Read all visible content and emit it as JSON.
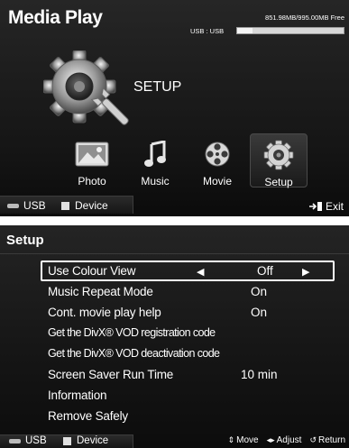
{
  "media_play": {
    "title": "Media Play",
    "usb_capacity": "851.98MB/995.00MB Free",
    "usb_label": "USB : USB",
    "usb_usage_fraction": 0.144,
    "hero_label": "SETUP",
    "items": [
      {
        "label": "Photo",
        "icon": "photo-icon"
      },
      {
        "label": "Music",
        "icon": "music-icon"
      },
      {
        "label": "Movie",
        "icon": "movie-icon"
      },
      {
        "label": "Setup",
        "icon": "gear-icon",
        "selected": true
      }
    ],
    "footer": {
      "usb_label": "USB",
      "device_label": "Device",
      "exit_label": "Exit"
    }
  },
  "setup": {
    "title": "Setup",
    "rows": [
      {
        "label": "Use Colour View",
        "value": "Off",
        "selected": true
      },
      {
        "label": "Music Repeat Mode",
        "value": "On"
      },
      {
        "label": "Cont. movie play help",
        "value": "On"
      },
      {
        "label": "Get the DivX® VOD registration code",
        "value": ""
      },
      {
        "label": "Get the DivX® VOD deactivation code",
        "value": ""
      },
      {
        "label": "Screen Saver Run Time",
        "value": "10 min"
      },
      {
        "label": "Information",
        "value": ""
      },
      {
        "label": "Remove Safely",
        "value": ""
      }
    ],
    "footer": {
      "usb_label": "USB",
      "device_label": "Device",
      "move_label": "Move",
      "adjust_label": "Adjust",
      "return_label": "Return"
    }
  },
  "colors": {
    "background": "#161616",
    "text": "#ffffff",
    "selection_border": "#ffffff"
  }
}
